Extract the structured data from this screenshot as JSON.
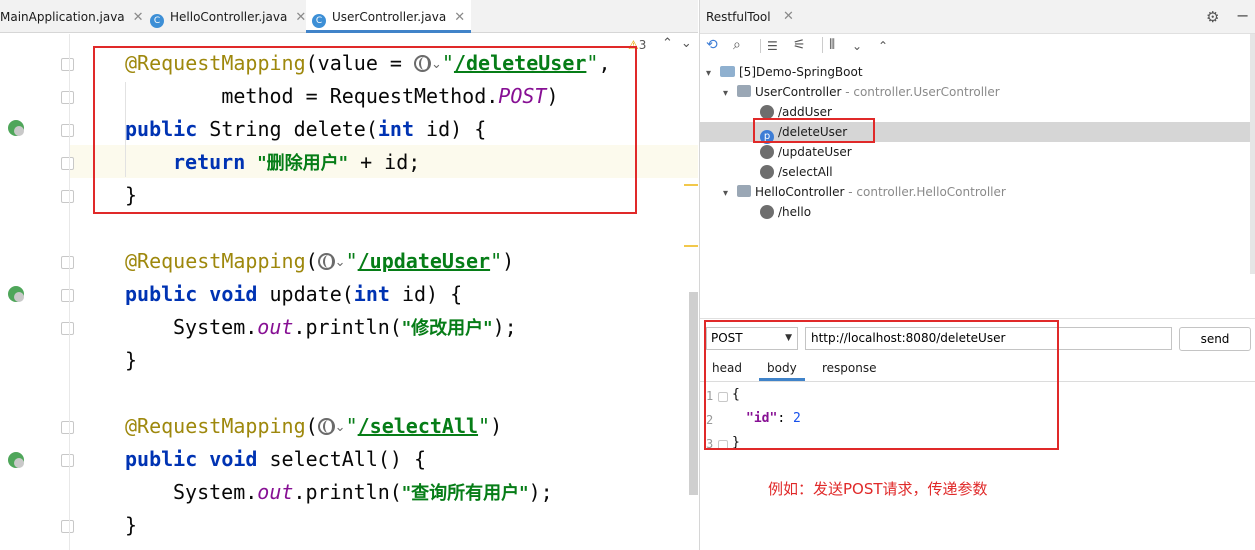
{
  "editor": {
    "tabs": [
      {
        "label": "MainApplication.java"
      },
      {
        "label": "HelloController.java"
      },
      {
        "label": "UserController.java"
      }
    ],
    "active_tab": "UserController.java",
    "warning_count": "3",
    "code": {
      "l1_ann": "@RequestMapping",
      "l1_a": "(value = ",
      "l1_url": "/deleteUser",
      "l1_b": ",",
      "l2_a": "        method = RequestMethod.",
      "l2_post": "POST",
      "l2_b": ")",
      "l3_kw1": "public",
      "l3_a": " String delete(",
      "l3_kw2": "int",
      "l3_b": " id) {",
      "l4_kw": "return",
      "l4_str": "\"删除用户\"",
      "l4_b": " + id;",
      "l5": "}",
      "l6_ann": "@RequestMapping",
      "l6_url": "/updateUser",
      "l7_kw1": "public",
      "l7_kw2": "void",
      "l7_a": " update(",
      "l7_kw3": "int",
      "l7_b": " id) {",
      "l8_a": "System.",
      "l8_out": "out",
      "l8_b": ".println(",
      "l8_str": "\"修改用户\"",
      "l8_c": ");",
      "l9": "}",
      "l10_ann": "@RequestMapping",
      "l10_url": "/selectAll",
      "l11_kw1": "public",
      "l11_kw2": "void",
      "l11_a": " selectAll() {",
      "l12_a": "System.",
      "l12_out": "out",
      "l12_b": ".println(",
      "l12_str": "\"查询所有用户\"",
      "l12_c": ");",
      "l13": "}"
    }
  },
  "restful_tool": {
    "title": "RestfulTool",
    "tree": {
      "project": "[5]Demo-SpringBoot",
      "controllers": [
        {
          "name": "UserController",
          "pkg": "- controller.UserController",
          "endpoints": [
            "/addUser",
            "/deleteUser",
            "/updateUser",
            "/selectAll"
          ]
        },
        {
          "name": "HelloController",
          "pkg": "- controller.HelloController",
          "endpoints": [
            "/hello"
          ]
        }
      ],
      "selected": "/deleteUser",
      "selected_badge": "p"
    },
    "request": {
      "method": "POST",
      "url": "http://localhost:8080/deleteUser",
      "send_label": "send",
      "tabs": [
        "head",
        "body",
        "response"
      ],
      "active_tab": "body",
      "body_lines": [
        {
          "n": "1",
          "text": "{"
        },
        {
          "n": "2",
          "key": "\"id\"",
          "sep": ": ",
          "val": "2"
        },
        {
          "n": "3",
          "text": "}"
        }
      ]
    }
  },
  "annotation_note": "例如：发送POST请求，传递参数",
  "colors": {
    "highlight_box": "#e02929",
    "accent": "#4083c9"
  }
}
